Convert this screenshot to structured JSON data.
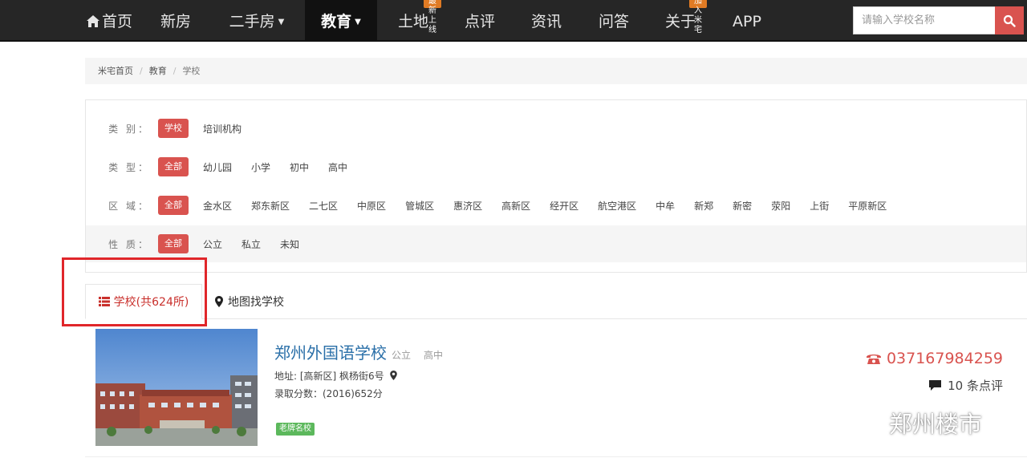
{
  "nav": {
    "home": "首页",
    "items": [
      {
        "label": "新房"
      },
      {
        "label": "二手房"
      },
      {
        "label": "教育"
      },
      {
        "label": "土地",
        "badge": "最新上线"
      },
      {
        "label": "点评"
      },
      {
        "label": "资讯"
      },
      {
        "label": "问答"
      },
      {
        "label": "关于",
        "badge": "加入米宅"
      },
      {
        "label": "APP"
      }
    ],
    "search_placeholder": "请输入学校名称"
  },
  "breadcrumb": [
    "米宅首页",
    "教育",
    "学校"
  ],
  "filters": {
    "category": {
      "label": "类 别：",
      "selected": "学校",
      "options": [
        "培训机构"
      ]
    },
    "type": {
      "label": "类 型：",
      "selected": "全部",
      "options": [
        "幼儿园",
        "小学",
        "初中",
        "高中"
      ]
    },
    "area": {
      "label": "区 域：",
      "selected": "全部",
      "options": [
        "金水区",
        "郑东新区",
        "二七区",
        "中原区",
        "管城区",
        "惠济区",
        "高新区",
        "经开区",
        "航空港区",
        "中牟",
        "新郑",
        "新密",
        "荥阳",
        "上街",
        "平原新区"
      ]
    },
    "nature": {
      "label": "性 质：",
      "selected": "全部",
      "options": [
        "公立",
        "私立",
        "未知"
      ]
    }
  },
  "tabs": {
    "schools": "学校(共624所)",
    "map": "地图找学校"
  },
  "school": {
    "name": "郑州外国语学校",
    "nature": "公立",
    "level": "高中",
    "address": "地址: [高新区] 枫杨街6号",
    "score": "录取分数：(2016)652分",
    "badge": "老牌名校",
    "phone": "037167984259",
    "reviews": "10 条点评"
  },
  "watermark": "郑州楼市",
  "colors": {
    "accent": "#d9534f",
    "nav_bg": "#262626",
    "link": "#2a6fa8",
    "badge_orange": "#e07b24",
    "badge_green": "#5cb85c"
  }
}
